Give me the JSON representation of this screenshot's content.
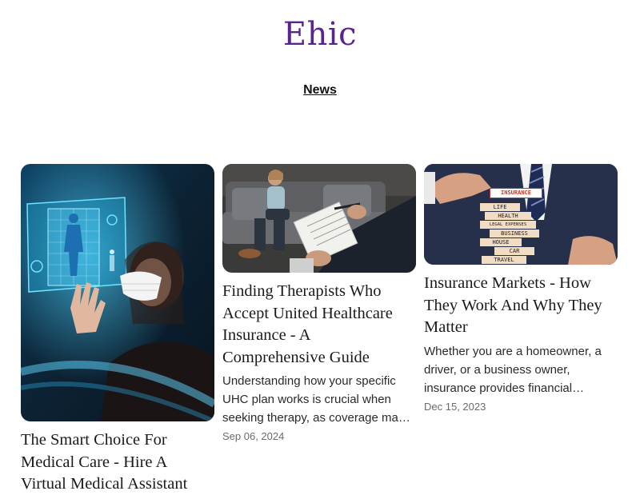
{
  "site": {
    "title": "Ehic"
  },
  "nav": {
    "news": "News"
  },
  "cards": [
    {
      "title": "The Smart Choice For Medical Care - Hire A Virtual Medical Assistant",
      "image_icon": "medical-scan-image"
    },
    {
      "title": "Finding Therapists Who Accept United Healthcare Insurance - A Comprehensive Guide",
      "excerpt": "Understanding how your specific UHC plan works is crucial when seeking therapy, as coverage may vary.",
      "date": "Sep 06, 2024",
      "image_icon": "therapy-session-image"
    },
    {
      "title": "Insurance Markets - How They Work And Why They Matter",
      "excerpt": "Whether you are a homeowner, a driver, or a business owner, insurance provides financial protection.",
      "date": "Dec 15, 2023",
      "image_icon": "insurance-blocks-image",
      "blocks": [
        "INSURANCE",
        "LIFE",
        "HEALTH",
        "LEGAL EXPENSES",
        "BUSINESS",
        "HOUSE",
        "CAR",
        "TRAVEL"
      ]
    }
  ],
  "colors": {
    "brand": "#5a2390",
    "text": "#1a1a1a",
    "muted": "#6b6b6b"
  }
}
